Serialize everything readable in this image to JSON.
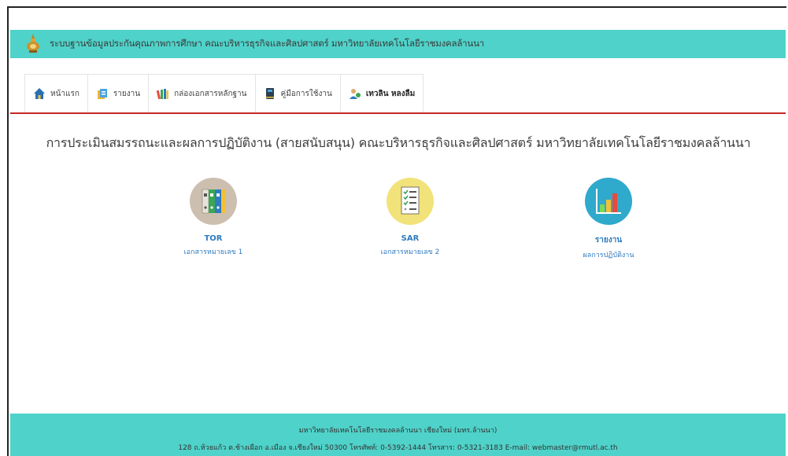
{
  "header": {
    "title": "ระบบฐานข้อมูลประกันคุณภาพการศึกษา คณะบริหารธุรกิจและศิลปศาสตร์ มหาวิทยาลัยเทคโนโลยีราชมงคลล้านนา"
  },
  "nav": {
    "items": [
      {
        "label": "หน้าแรก",
        "icon": "home-icon"
      },
      {
        "label": "รายงาน",
        "icon": "report-icon"
      },
      {
        "label": "กล่องเอกสารหลักฐาน",
        "icon": "books-icon"
      },
      {
        "label": "คู่มือการใช้งาน",
        "icon": "manual-icon"
      },
      {
        "label": "เทวลิน หลงลืม",
        "icon": "user-icon"
      }
    ]
  },
  "main": {
    "title": "การประเมินสมรรถนะและผลการปฏิบัติงาน (สายสนับสนุน) คณะบริหารธุรกิจและศิลปศาสตร์ มหาวิทยาลัยเทคโนโลยีราชมงคลล้านนา",
    "tiles": [
      {
        "label": "TOR",
        "sublabel": "เอกสารหมายเลข 1",
        "icon": "binders-icon",
        "color": "#cdbfb0"
      },
      {
        "label": "SAR",
        "sublabel": "เอกสารหมายเลข 2",
        "icon": "checklist-icon",
        "color": "#f2e27a"
      },
      {
        "label": "รายงาน",
        "sublabel": "ผลการปฏิบัติงาน",
        "icon": "bar-chart-icon",
        "color": "#2fa9cc"
      }
    ]
  },
  "footer": {
    "line1": "มหาวิทยาลัยเทคโนโลยีราชมงคลล้านนา เชียงใหม่ (มทร.ล้านนา)",
    "line2": "128 ถ.ห้วยแก้ว ต.ช้างเผือก อ.เมือง จ.เชียงใหม่ 50300 โทรศัพท์: 0-5392-1444 โทรสาร: 0-5321-3183 E-mail: webmaster@rmutl.ac.th"
  },
  "colors": {
    "header_bg": "#4fd2c9",
    "accent_line": "#c62828",
    "link": "#2f7bbf"
  }
}
